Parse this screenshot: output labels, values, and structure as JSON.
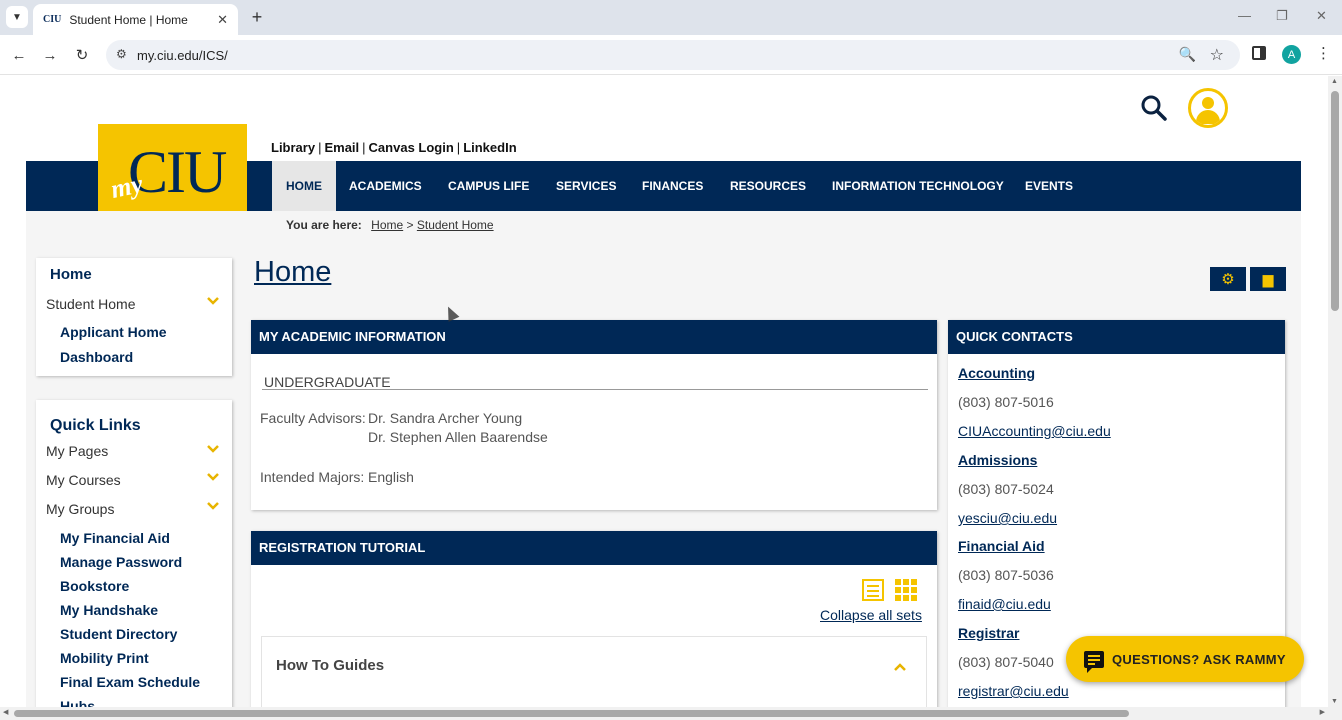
{
  "browser": {
    "tab_title": "Student Home | Home",
    "tab_favicon_text": "CIU",
    "url": "my.ciu.edu/ICS/",
    "profile_initial": "A"
  },
  "header": {
    "logo_my": "my",
    "logo_ciu": "CIU",
    "top_links": [
      "Library",
      "Email",
      "Canvas Login",
      "LinkedIn"
    ],
    "nav": [
      "HOME",
      "ACADEMICS",
      "CAMPUS LIFE",
      "SERVICES",
      "FINANCES",
      "RESOURCES",
      "INFORMATION TECHNOLOGY",
      "EVENTS"
    ]
  },
  "breadcrumb": {
    "label": "You are here:",
    "home": "Home",
    "separator": ">",
    "current": "Student Home"
  },
  "sidebar": {
    "context": {
      "heading": "Home",
      "student_home": "Student Home",
      "items": [
        "Applicant Home",
        "Dashboard"
      ]
    },
    "quick_links": {
      "heading": "Quick Links",
      "groups": [
        "My Pages",
        "My Courses",
        "My Groups"
      ],
      "items": [
        "My Financial Aid",
        "Manage Password",
        "Bookstore",
        "My Handshake",
        "Student Directory",
        "Mobility Print",
        "Final Exam Schedule",
        "Hubs"
      ]
    }
  },
  "main": {
    "title": "Home",
    "academic": {
      "header": "MY ACADEMIC INFORMATION",
      "level": "UNDERGRADUATE",
      "advisors_label": "Faculty Advisors:",
      "advisors": [
        "Dr. Sandra Archer Young",
        "Dr. Stephen Allen Baarendse"
      ],
      "majors_label": "Intended Majors:",
      "majors": "English"
    },
    "tutorial": {
      "header": "REGISTRATION TUTORIAL",
      "collapse_label": "Collapse all sets",
      "guides_title": "How To Guides"
    }
  },
  "contacts": {
    "header": "QUICK CONTACTS",
    "entries": [
      {
        "name": "Accounting",
        "phone": "(803) 807-5016",
        "email": "CIUAccounting@ciu.edu"
      },
      {
        "name": "Admissions",
        "phone": "(803) 807-5024",
        "email": "yesciu@ciu.edu"
      },
      {
        "name": "Financial Aid",
        "phone": "(803) 807-5036",
        "email": "finaid@ciu.edu"
      },
      {
        "name": "Registrar",
        "phone": "(803) 807-5040",
        "email": "registrar@ciu.edu"
      }
    ]
  },
  "chat": {
    "label": "QUESTIONS? ASK RAMMY"
  },
  "colors": {
    "navy": "#002856",
    "gold": "#f5c400"
  }
}
